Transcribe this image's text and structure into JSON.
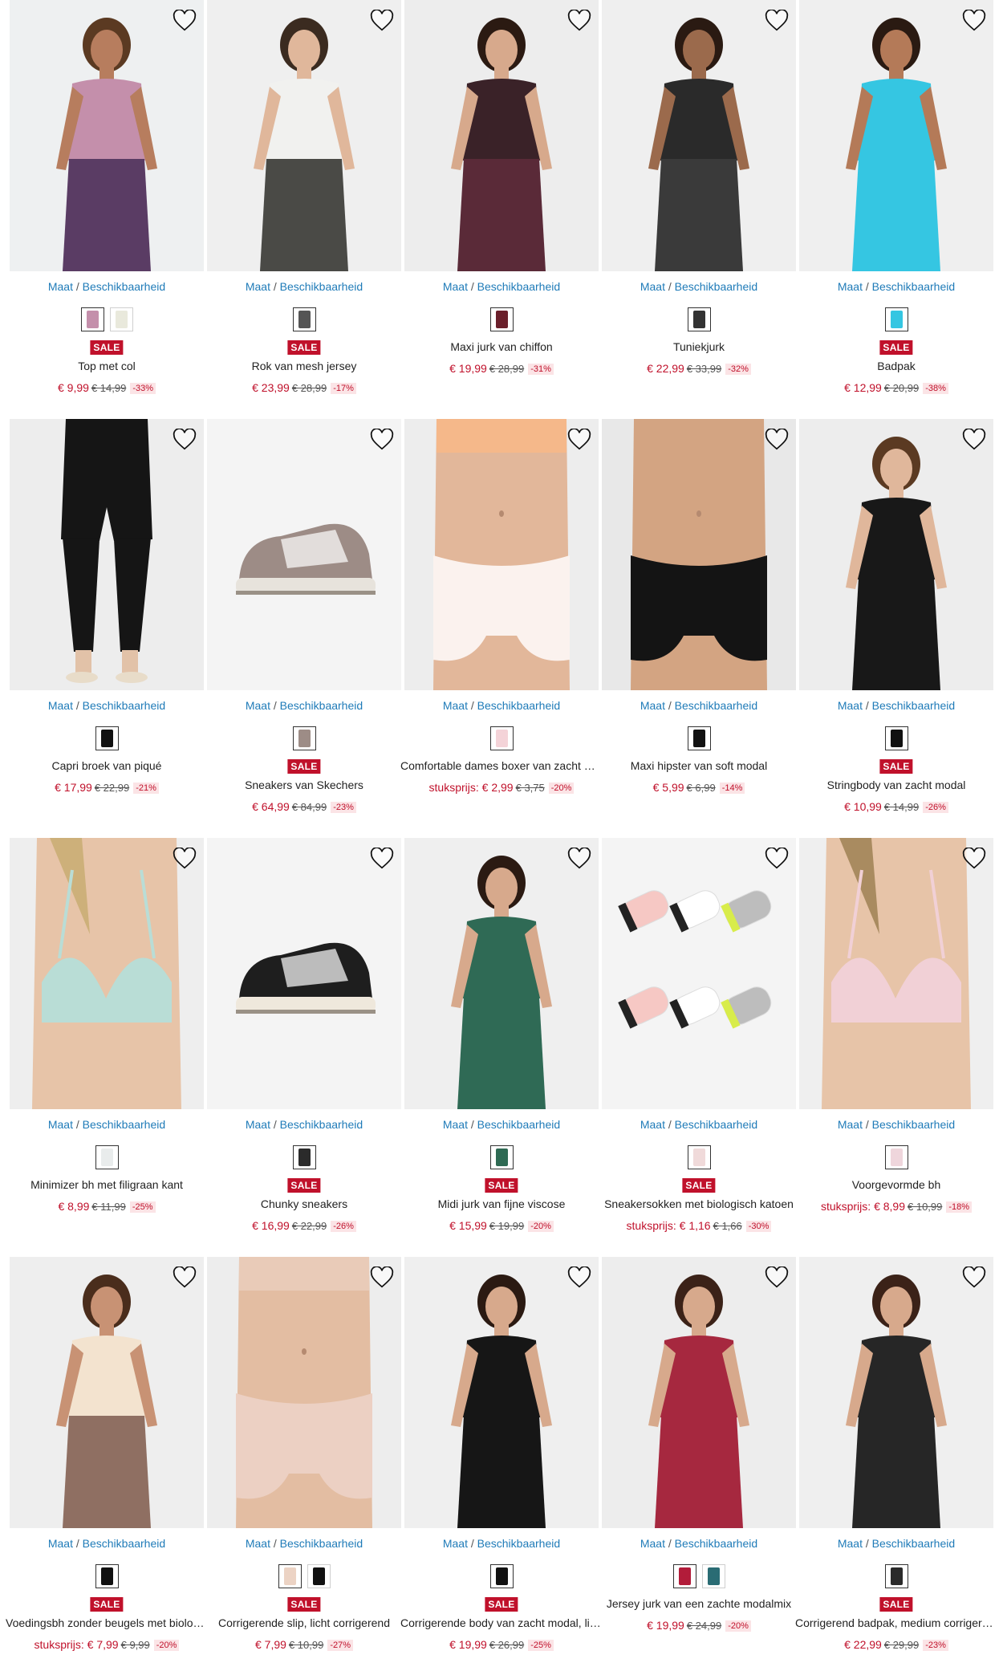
{
  "availability_label": "Maat",
  "availability_suffix": "Beschikbaarheid",
  "sale_label": "SALE",
  "colors": {
    "accent": "#c0112b",
    "link": "#1f7bb8",
    "discount_bg": "#fbe4e6"
  },
  "products": [
    {
      "name": "Top met col",
      "price": "€ 9,99",
      "old": "€ 14,99",
      "discount": "-33%",
      "sale": true,
      "swatches": [
        "#c48fab",
        "#e9e9dc"
      ],
      "scene": "model",
      "colors": {
        "bg": "#eef0f1",
        "top": "#c48fab",
        "bottom": "#5a3c64",
        "skin": "#b77d5e",
        "hair": "#5b3a22"
      }
    },
    {
      "name": "Rok van mesh jersey",
      "price": "€ 23,99",
      "old": "€ 28,99",
      "discount": "-17%",
      "sale": true,
      "swatches": [
        "#555555"
      ],
      "scene": "model",
      "colors": {
        "bg": "#efefef",
        "top": "#f1f1ef",
        "bottom": "#4a4a46",
        "skin": "#e0b79b",
        "hair": "#3b2b20"
      }
    },
    {
      "name": "Maxi jurk van chiffon",
      "price": "€ 19,99",
      "old": "€ 28,99",
      "discount": "-31%",
      "sale": false,
      "swatches": [
        "#6a1f2b"
      ],
      "scene": "model",
      "colors": {
        "bg": "#ededed",
        "top": "#3a2228",
        "bottom": "#5a2a38",
        "skin": "#d7a98c",
        "hair": "#2b1a12"
      }
    },
    {
      "name": "Tuniekjurk",
      "price": "€ 22,99",
      "old": "€ 33,99",
      "discount": "-32%",
      "sale": false,
      "swatches": [
        "#333333"
      ],
      "scene": "model",
      "colors": {
        "bg": "#efefef",
        "top": "#2a2a2a",
        "bottom": "#3a3a3a",
        "skin": "#9b6a4c",
        "hair": "#2a1a12"
      }
    },
    {
      "name": "Badpak",
      "price": "€ 12,99",
      "old": "€ 20,99",
      "discount": "-38%",
      "sale": true,
      "swatches": [
        "#35c6e2"
      ],
      "scene": "model",
      "colors": {
        "bg": "#efefef",
        "top": "#35c6e2",
        "bottom": "#35c6e2",
        "skin": "#b47a58",
        "hair": "#2a1a12"
      }
    },
    {
      "name": "Capri broek van piqué",
      "price": "€ 17,99",
      "old": "€ 22,99",
      "discount": "-21%",
      "sale": false,
      "swatches": [
        "#111111"
      ],
      "scene": "legs",
      "colors": {
        "bg": "#ededed",
        "top": "#151515",
        "bottom": "#151515",
        "skin": "#e2c2a8",
        "hair": "#151515"
      }
    },
    {
      "name": "Sneakers van Skechers",
      "price": "€ 64,99",
      "old": "€ 84,99",
      "discount": "-23%",
      "sale": true,
      "swatches": [
        "#9d8c86"
      ],
      "scene": "shoe",
      "colors": {
        "bg": "#f4f4f4",
        "top": "#9d8c86",
        "bottom": "#e7e3dc",
        "skin": "#ffffff",
        "hair": "#333333"
      }
    },
    {
      "name": "Comfortable dames boxer van zacht modal",
      "prefix": "stuksprijs:",
      "price": "€ 2,99",
      "old": "€ 3,75",
      "discount": "-20%",
      "sale": false,
      "swatches": [
        "#f4d3d8"
      ],
      "scene": "torso",
      "colors": {
        "bg": "#ededed",
        "top": "#f5b88a",
        "bottom": "#fbf2ee",
        "skin": "#e2b79a",
        "hair": "#e2b79a"
      }
    },
    {
      "name": "Maxi hipster van soft modal",
      "price": "€ 5,99",
      "old": "€ 6,99",
      "discount": "-14%",
      "sale": false,
      "swatches": [
        "#111111"
      ],
      "scene": "torso",
      "colors": {
        "bg": "#e8e8e8",
        "top": "#d3a482",
        "bottom": "#141414",
        "skin": "#d3a482",
        "hair": "#d3a482"
      }
    },
    {
      "name": "Stringbody van zacht modal",
      "price": "€ 10,99",
      "old": "€ 14,99",
      "discount": "-26%",
      "sale": true,
      "swatches": [
        "#111111"
      ],
      "scene": "model",
      "colors": {
        "bg": "#ededed",
        "top": "#181818",
        "bottom": "#181818",
        "skin": "#e0b79b",
        "hair": "#5b3a22"
      }
    },
    {
      "name": "Minimizer bh met filigraan kant",
      "price": "€ 8,99",
      "old": "€ 11,99",
      "discount": "-25%",
      "sale": false,
      "swatches": [
        "#e9ecec"
      ],
      "scene": "bra",
      "colors": {
        "bg": "#eeeeee",
        "top": "#b9ddd6",
        "bottom": "#b9ddd6",
        "skin": "#e7c4a8",
        "hair": "#cdb07a"
      }
    },
    {
      "name": "Chunky sneakers",
      "price": "€ 16,99",
      "old": "€ 22,99",
      "discount": "-26%",
      "sale": true,
      "swatches": [
        "#2b2b2b"
      ],
      "scene": "shoe",
      "colors": {
        "bg": "#f4f4f4",
        "top": "#1e1e1e",
        "bottom": "#efe8dc",
        "skin": "#d8a58c",
        "hair": "#333333"
      }
    },
    {
      "name": "Midi jurk van fijne viscose",
      "price": "€ 15,99",
      "old": "€ 19,99",
      "discount": "-20%",
      "sale": true,
      "swatches": [
        "#2e6a53"
      ],
      "scene": "model",
      "colors": {
        "bg": "#efefef",
        "top": "#2f6a55",
        "bottom": "#2f6a55",
        "skin": "#d7a98c",
        "hair": "#2b1a12"
      }
    },
    {
      "name": "Sneakersokken met biologisch katoen",
      "prefix": "stuksprijs:",
      "price": "€ 1,16",
      "old": "€ 1,66",
      "discount": "-30%",
      "sale": true,
      "swatches": [
        "#f0dada"
      ],
      "scene": "socks",
      "colors": {
        "bg": "#f4f4f4",
        "top": "#f6c8c4",
        "bottom": "#ffffff",
        "skin": "#bdbdbd",
        "hair": "#d8ec4a"
      }
    },
    {
      "name": "Voorgevormde bh",
      "prefix": "stuksprijs:",
      "price": "€ 8,99",
      "old": "€ 10,99",
      "discount": "-18%",
      "sale": false,
      "swatches": [
        "#efd6dc"
      ],
      "scene": "bra",
      "colors": {
        "bg": "#efefef",
        "top": "#f1d0d6",
        "bottom": "#f1d0d6",
        "skin": "#e7c4a8",
        "hair": "#a98b60"
      }
    },
    {
      "name": "Voedingsbh zonder beugels met biologisch katoen",
      "prefix": "stuksprijs:",
      "price": "€ 7,99",
      "old": "€ 9,99",
      "discount": "-20%",
      "sale": true,
      "swatches": [
        "#111111"
      ],
      "scene": "model",
      "colors": {
        "bg": "#eeeeee",
        "top": "#f3e3cf",
        "bottom": "#8f6f62",
        "skin": "#c89274",
        "hair": "#4a2d1c"
      }
    },
    {
      "name": "Corrigerende slip, licht corrigerend",
      "price": "€ 7,99",
      "old": "€ 10,99",
      "discount": "-27%",
      "sale": true,
      "swatches": [
        "#ecd3c4",
        "#111111"
      ],
      "scene": "torso",
      "colors": {
        "bg": "#ededed",
        "top": "#e9cbb8",
        "bottom": "#ecd0c3",
        "skin": "#e3bda2",
        "hair": "#e3bda2"
      }
    },
    {
      "name": "Corrigerende body van zacht modal, licht corrigerend",
      "price": "€ 19,99",
      "old": "€ 26,99",
      "discount": "-25%",
      "sale": true,
      "swatches": [
        "#111111"
      ],
      "scene": "model",
      "colors": {
        "bg": "#efefef",
        "top": "#161616",
        "bottom": "#161616",
        "skin": "#d7a98c",
        "hair": "#2b1a12"
      }
    },
    {
      "name": "Jersey jurk van een zachte modalmix",
      "price": "€ 19,99",
      "old": "€ 24,99",
      "discount": "-20%",
      "sale": false,
      "swatches": [
        "#b21c3a",
        "#2a6c74"
      ],
      "scene": "model",
      "colors": {
        "bg": "#ededed",
        "top": "#a6283f",
        "bottom": "#a6283f",
        "skin": "#d7a98c",
        "hair": "#3b2218"
      }
    },
    {
      "name": "Corrigerend badpak, medium corrigerend",
      "price": "€ 22,99",
      "old": "€ 29,99",
      "discount": "-23%",
      "sale": true,
      "swatches": [
        "#2a2a2a"
      ],
      "scene": "model",
      "colors": {
        "bg": "#efefef",
        "top": "#262626",
        "bottom": "#262626",
        "skin": "#d7a98c",
        "hair": "#3b2218"
      }
    }
  ]
}
